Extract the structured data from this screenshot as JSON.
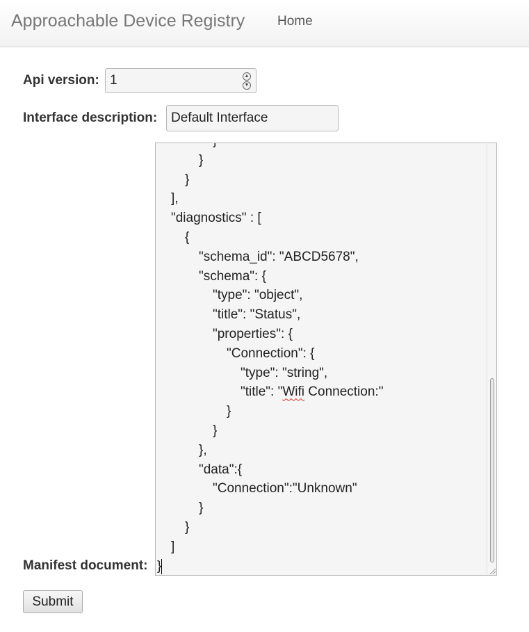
{
  "navbar": {
    "brand": "Approachable Device Registry",
    "home_label": "Home"
  },
  "form": {
    "api_version": {
      "label": "Api version:",
      "value": "1"
    },
    "interface_description": {
      "label": "Interface description:",
      "value": "Default Interface"
    },
    "manifest_document": {
      "label": "Manifest document:",
      "lines": [
        "            }",
        "        }",
        "    }",
        "],",
        "\"diagnostics\" : [",
        "    {",
        "        \"schema_id\": \"ABCD5678\",",
        "        \"schema\": {",
        "            \"type\": \"object\",",
        "            \"title\": \"Status\",",
        "            \"properties\": {",
        "                \"Connection\": {",
        "                    \"type\": \"string\",",
        "                    \"title\": \"Wifi Connection:\"",
        "                }",
        "            }",
        "        },",
        "        \"data\":{",
        "            \"Connection\":\"Unknown\"",
        "        }",
        "    }",
        "]",
        "}"
      ]
    },
    "submit_label": "Submit"
  }
}
